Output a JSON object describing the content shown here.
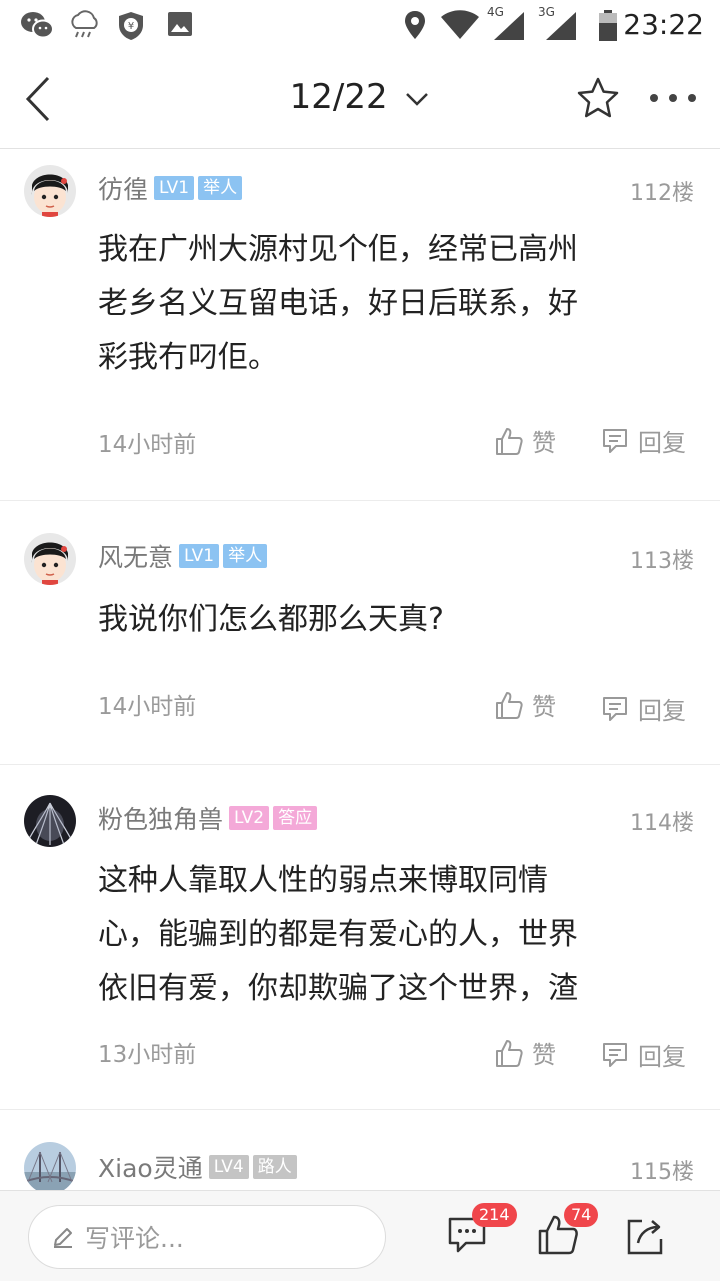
{
  "status_bar": {
    "left_icons": [
      "wechat-icon",
      "cloud-rain-icon",
      "shield-yen-icon",
      "image-icon"
    ],
    "right_icons": [
      "location-icon",
      "wifi-icon",
      "signal-4g-icon",
      "signal-3g-icon",
      "battery-icon"
    ],
    "net1": "4G",
    "net2": "3G",
    "time": "23:22"
  },
  "nav": {
    "page": "12/22",
    "icons": [
      "back-icon",
      "chevron-down-icon",
      "star-icon",
      "more-icon"
    ]
  },
  "comments": [
    {
      "username": "彷徨",
      "level": "LV1",
      "title": "举人",
      "floor": "112楼",
      "lines": [
        "我在广州大源村见个佢，经常已高州",
        "老乡名义互留电话，好日后联系，好",
        "彩我冇叼佢。"
      ],
      "time": "14小时前",
      "like_label": "赞",
      "reply_label": "回复"
    },
    {
      "username": "风无意",
      "level": "LV1",
      "title": "举人",
      "floor": "113楼",
      "lines": [
        "我说你们怎么都那么天真?"
      ],
      "time": "14小时前",
      "like_label": "赞",
      "reply_label": "回复"
    },
    {
      "username": "粉色独角兽",
      "level": "LV2",
      "title": "答应",
      "floor": "114楼",
      "lines": [
        "这种人靠取人性的弱点来博取同情",
        "心，能骗到的都是有爱心的人，世界",
        "依旧有爱，你却欺骗了这个世界，渣"
      ],
      "time": "13小时前",
      "like_label": "赞",
      "reply_label": "回复"
    },
    {
      "username": "Xiao灵通",
      "level": "LV4",
      "title": "路人",
      "floor": "115楼"
    }
  ],
  "bottom_bar": {
    "input_placeholder": "写评论...",
    "comment_count": "214",
    "like_count": "74",
    "icons": [
      "pencil-icon",
      "comments-icon",
      "thumbs-up-icon",
      "share-icon"
    ]
  },
  "colors": {
    "badge_blue": "#8cc3f2",
    "badge_pink": "#f4a9d8",
    "badge_gray": "#c4c4c4",
    "count_badge": "#f0464b"
  }
}
